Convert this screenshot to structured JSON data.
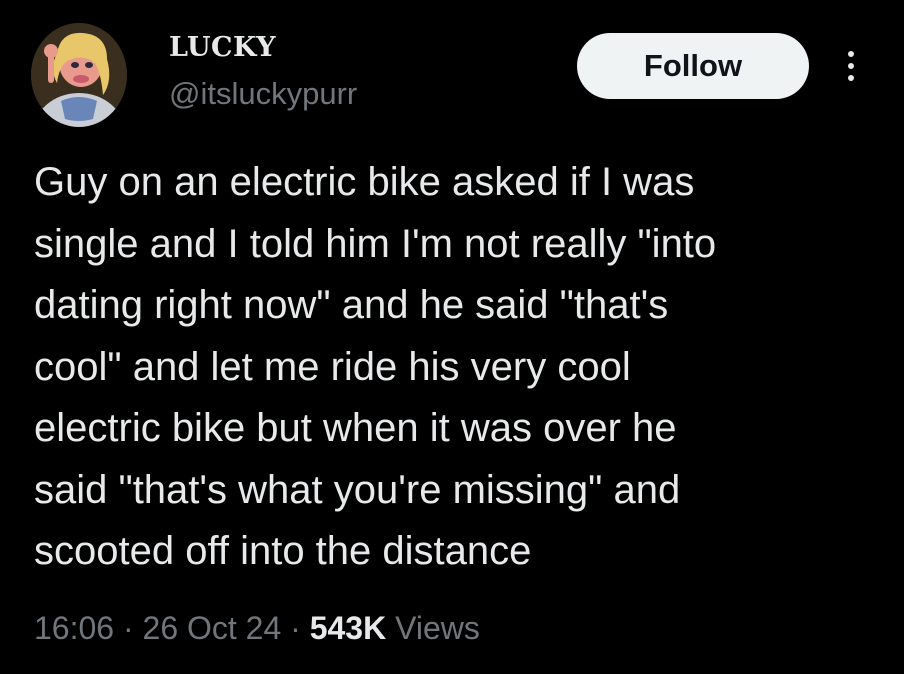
{
  "author": {
    "display_name": "LUCKY",
    "handle": "@itsluckypurr",
    "avatar_icon": "profile-avatar"
  },
  "actions": {
    "follow_label": "Follow",
    "more_icon": "more-vertical-icon"
  },
  "tweet": {
    "text": "Guy on an electric bike asked if I was\nsingle and I told him I'm not really \"into\ndating right now\" and he said \"that's\ncool\" and let me ride his very cool\nelectric bike but when it was over he\nsaid \"that's what you're missing\" and\nscooted off into the distance"
  },
  "meta": {
    "time": "16:06",
    "separator": " · ",
    "date": "26 Oct 24",
    "views_count": "543K",
    "views_label": " Views"
  },
  "colors": {
    "background": "#000000",
    "primary_text": "#e7e9ea",
    "secondary_text": "#71767b",
    "follow_bg": "#eff3f4",
    "follow_text": "#0f1419"
  }
}
